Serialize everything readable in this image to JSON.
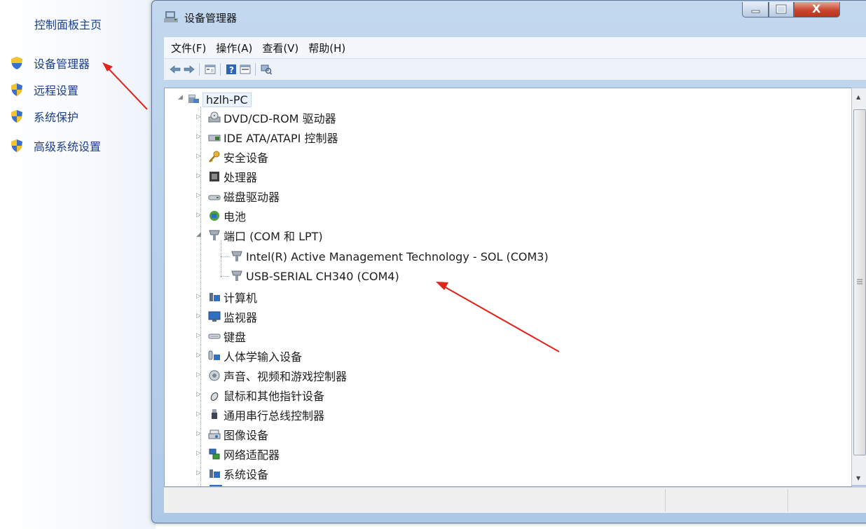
{
  "control_panel": {
    "home_link": "控制面板主页",
    "links": [
      "设备管理器",
      "远程设置",
      "系统保护",
      "高级系统设置"
    ]
  },
  "window": {
    "title": "设备管理器",
    "menu": [
      "文件(F)",
      "操作(A)",
      "查看(V)",
      "帮助(H)"
    ],
    "close_glyph": "X"
  },
  "tree": {
    "root": "hzlh-PC",
    "categories": [
      "DVD/CD-ROM 驱动器",
      "IDE ATA/ATAPI 控制器",
      "安全设备",
      "处理器",
      "磁盘驱动器",
      "电池",
      "端口 (COM 和 LPT)",
      "计算机",
      "监视器",
      "键盘",
      "人体学输入设备",
      "声音、视频和游戏控制器",
      "鼠标和其他指针设备",
      "通用串行总线控制器",
      "图像设备",
      "网络适配器",
      "系统设备"
    ],
    "port_children": [
      "Intel(R) Active Management Technology - SOL (COM3)",
      "USB-SERIAL CH340 (COM4)"
    ]
  },
  "colors": {
    "link": "#1a3e8c",
    "annotation_arrow": "#e0231b"
  }
}
